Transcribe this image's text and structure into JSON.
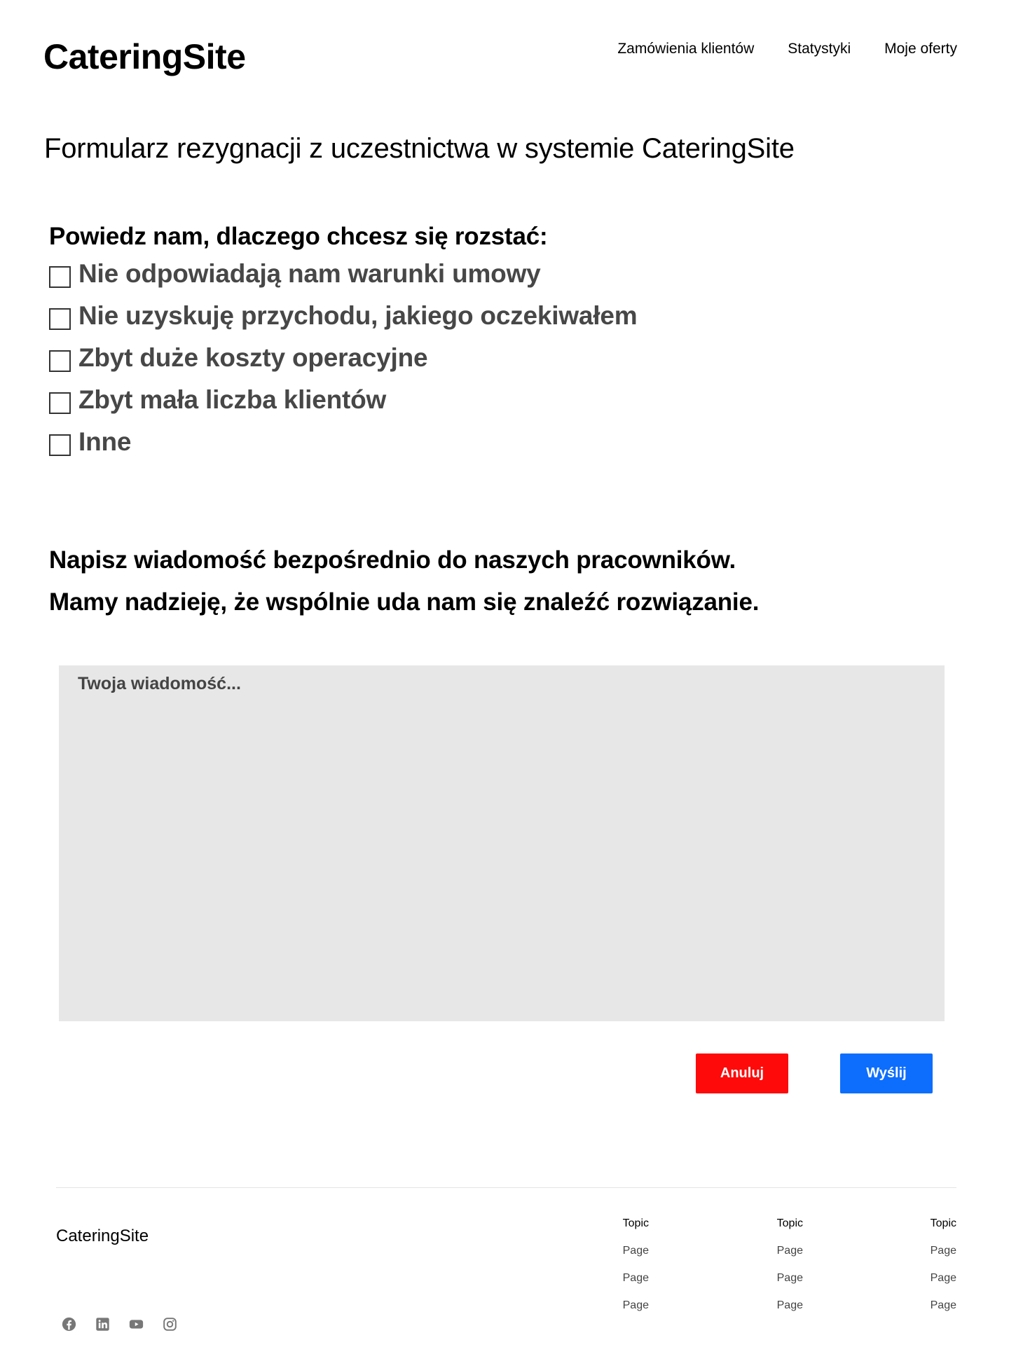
{
  "header": {
    "logo": "CateringSite",
    "nav": [
      "Zamówienia klientów",
      "Statystyki",
      "Moje oferty"
    ]
  },
  "form": {
    "title": "Formularz rezygnacji z uczestnictwa w systemie CateringSite",
    "reasons_heading": "Powiedz nam, dlaczego chcesz się rozstać:",
    "reasons": [
      "Nie odpowiadają nam warunki umowy",
      "Nie uzyskuję przychodu, jakiego oczekiwałem",
      "Zbyt duże koszty operacyjne",
      "Zbyt mała liczba klientów",
      "Inne"
    ],
    "message_line1": "Napisz wiadomość bezpośrednio do naszych pracowników.",
    "message_line2": "Mamy nadzieję, że wspólnie uda nam się znaleźć rozwiązanie.",
    "message_placeholder": "Twoja wiadomość...",
    "cancel_label": "Anuluj",
    "send_label": "Wyślij",
    "colors": {
      "cancel": "#ff0a0a",
      "send": "#0d6efd",
      "textarea_bg": "#e7e7e7"
    }
  },
  "footer": {
    "brand": "CateringSite",
    "columns": [
      {
        "topic": "Topic",
        "pages": [
          "Page",
          "Page",
          "Page"
        ]
      },
      {
        "topic": "Topic",
        "pages": [
          "Page",
          "Page",
          "Page"
        ]
      },
      {
        "topic": "Topic",
        "pages": [
          "Page",
          "Page",
          "Page"
        ]
      }
    ],
    "social_icons": [
      "facebook-icon",
      "linkedin-icon",
      "youtube-icon",
      "instagram-icon"
    ]
  }
}
